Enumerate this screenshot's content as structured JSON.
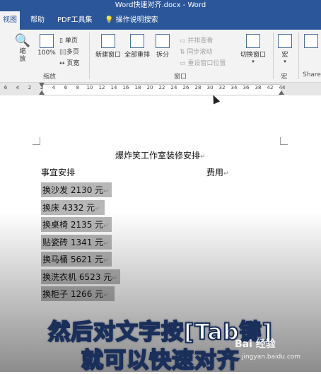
{
  "window": {
    "title": "Word快速对齐.docx - Word"
  },
  "tabs": [
    {
      "label": "视图",
      "active": true
    },
    {
      "label": "帮助",
      "active": false
    },
    {
      "label": "PDF工具集",
      "active": false
    }
  ],
  "tell_me": {
    "label": "操作说明搜索"
  },
  "ribbon": {
    "zoom_group": {
      "zoom_label": "缩\n放",
      "percent_label": "100%",
      "one_page": "单页",
      "multi_page": "多页",
      "page_width": "页宽",
      "group_label": "缩放"
    },
    "window_group": {
      "new_window": "新建窗口",
      "arrange_all": "全部重排",
      "split": "拆分",
      "side_by_side": "并排查看",
      "sync_scroll": "同步滚动",
      "reset_position": "重设窗口位置",
      "switch_window": "切换窗口",
      "group_label": "窗口"
    },
    "macro_group": {
      "macro_label": "宏",
      "group_label": "宏"
    },
    "share_group": {
      "group_label": "Share"
    }
  },
  "ruler": {
    "numbers": [
      "6",
      "4",
      "2",
      "2",
      "4",
      "6",
      "8",
      "10",
      "12",
      "14",
      "16",
      "18",
      "20",
      "22",
      "24",
      "26",
      "28",
      "30",
      "32",
      "34",
      "36",
      "38",
      "42",
      "44"
    ]
  },
  "document": {
    "title": "爆炸笑工作室装修安排",
    "header_left": "事宜安排",
    "header_right": "费用",
    "items": [
      "换沙发 2130 元",
      "换床 4332 元",
      "换桌椅 2135 元",
      "贴瓷砖 1341 元",
      "换马桶 5621 元",
      "换洗衣机 6523 元",
      "换柜子 1266 元"
    ],
    "para_mark": "↵"
  },
  "caption": {
    "line1": "然后对文字按[Tab键]",
    "line2": "就可以快速对齐"
  },
  "watermark": {
    "brand": "Bai 经验",
    "url": "jingyan.baidu.com"
  },
  "colors": {
    "word_blue": "#2b579a",
    "selection": "#b7b7b7"
  }
}
